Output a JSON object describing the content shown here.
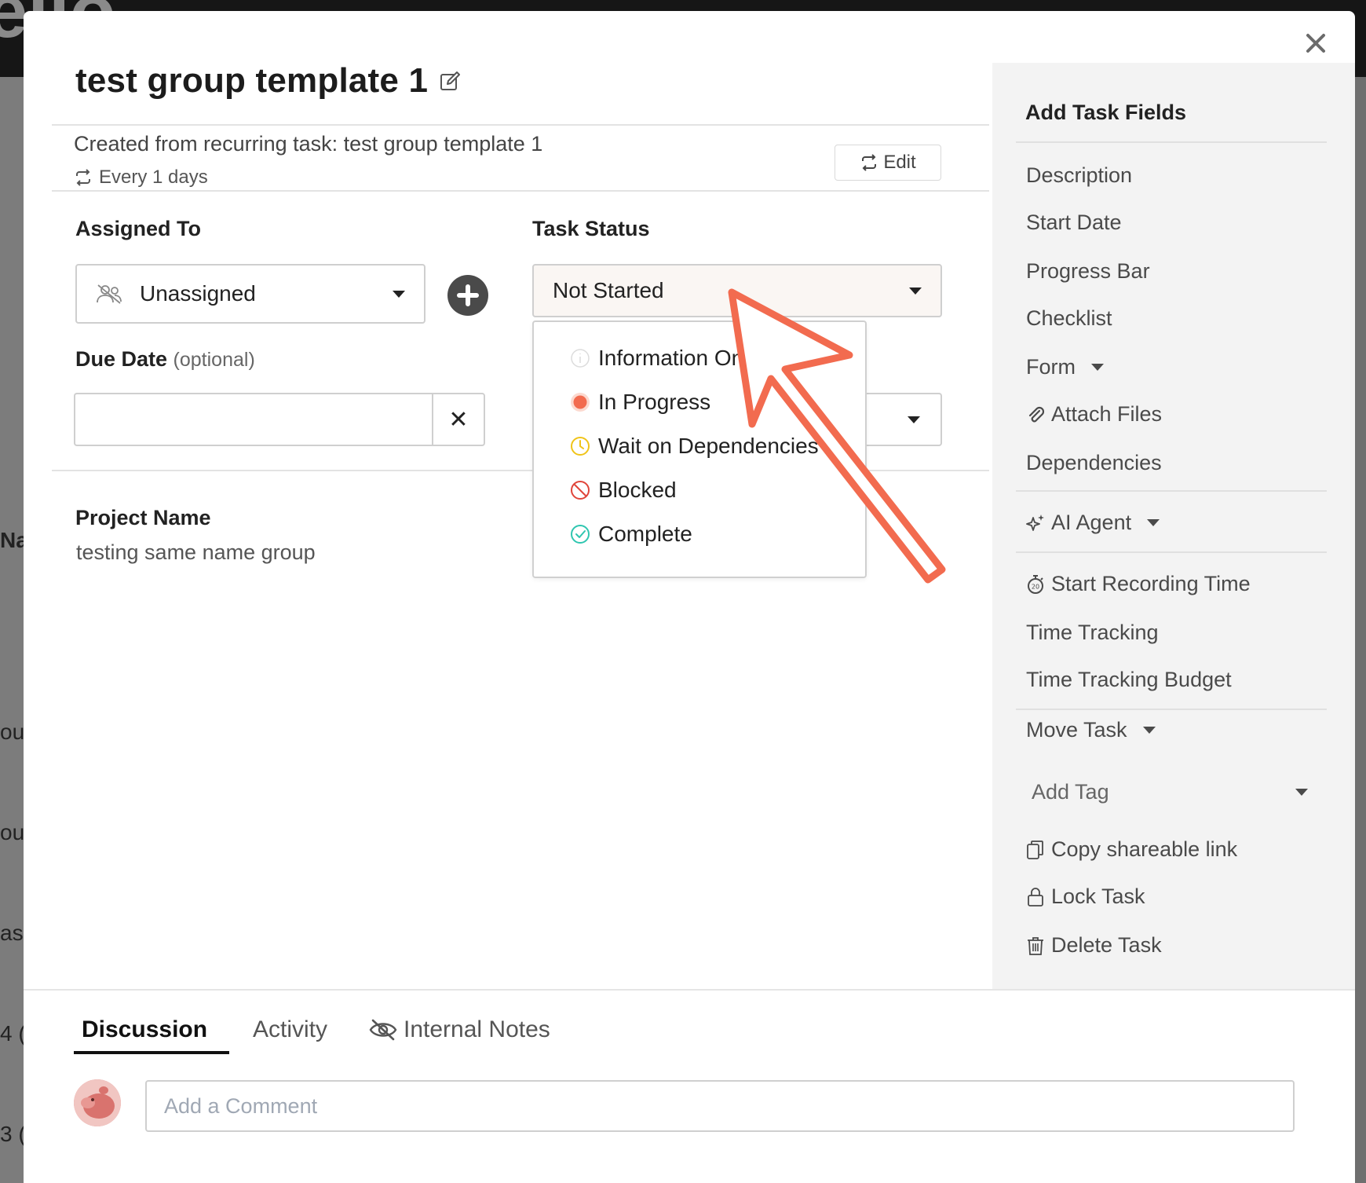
{
  "background": {
    "logo_text": "ello",
    "frag_1": "Na",
    "frag_2": "ou",
    "frag_3": "ou",
    "frag_4": "as",
    "frag_5": "4 (",
    "frag_6": "3 ("
  },
  "modal": {
    "title": "test group template 1",
    "recurring_text": "Created from recurring task: test group template 1",
    "recurring_freq": "Every 1 days",
    "edit_label": "Edit"
  },
  "fields": {
    "assigned_to_label": "Assigned To",
    "assigned_value": "Unassigned",
    "task_status_label": "Task Status",
    "status_value": "Not Started",
    "due_date_label": "Due Date",
    "due_date_optional": "(optional)",
    "due_date_clear": "✕",
    "project_name_label": "Project Name",
    "project_name_value": "testing same name group"
  },
  "status_dropdown": {
    "items": [
      {
        "label": "Information Only",
        "color": "#d6d6d6"
      },
      {
        "label": "In Progress",
        "color": "#f26b4f"
      },
      {
        "label": "Wait on Dependencies",
        "color": "#f0c419"
      },
      {
        "label": "Blocked",
        "color": "#e0453a"
      },
      {
        "label": "Complete",
        "color": "#2fc6b0"
      }
    ]
  },
  "sidebar": {
    "title": "Add Task Fields",
    "items": {
      "description": "Description",
      "start_date": "Start Date",
      "progress_bar": "Progress Bar",
      "checklist": "Checklist",
      "form": "Form",
      "attach_files": "Attach Files",
      "dependencies": "Dependencies",
      "ai_agent": "AI Agent",
      "start_recording": "Start Recording Time",
      "time_tracking": "Time Tracking",
      "time_tracking_budget": "Time Tracking Budget",
      "move_task": "Move Task",
      "add_tag": "Add Tag",
      "copy_link": "Copy shareable link",
      "lock_task": "Lock Task",
      "delete_task": "Delete Task"
    }
  },
  "tabs": {
    "discussion": "Discussion",
    "activity": "Activity",
    "internal_notes": "Internal Notes"
  },
  "comment": {
    "placeholder": "Add a Comment"
  },
  "colors": {
    "arrow": "#f26b4f",
    "accent_dark": "#4a4a4a"
  }
}
